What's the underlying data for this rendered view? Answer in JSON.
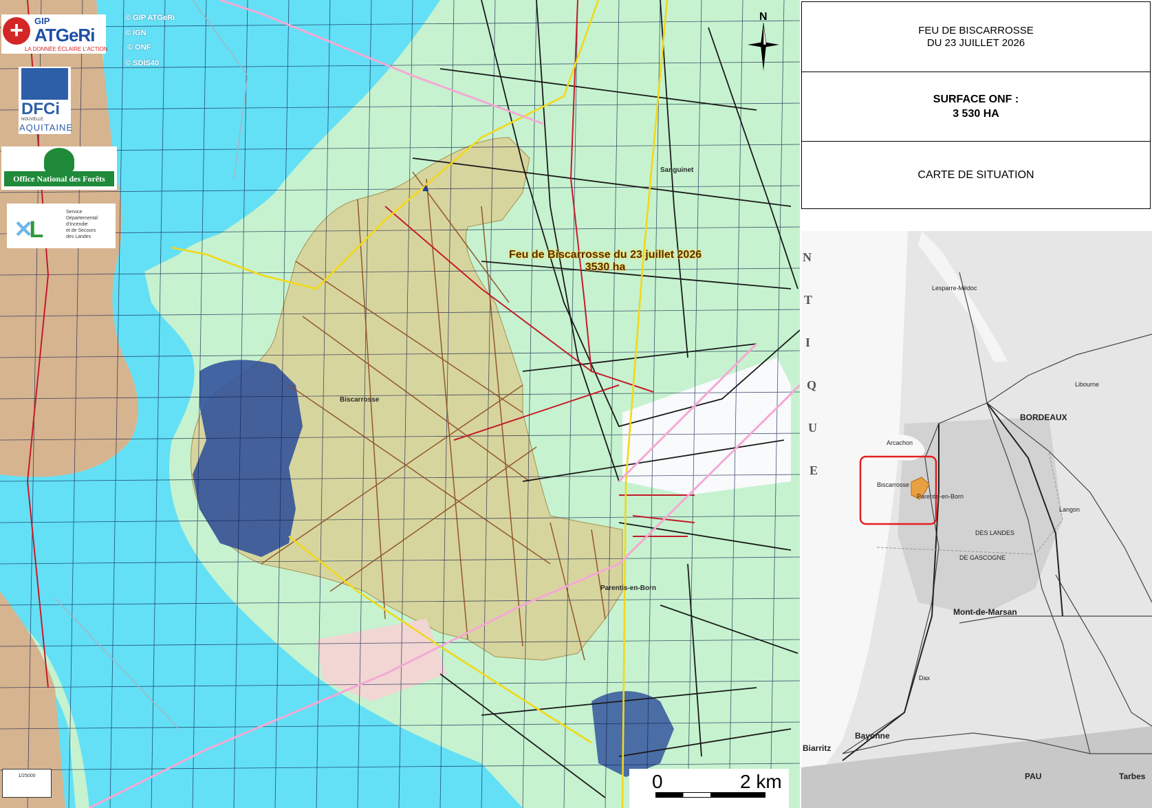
{
  "map": {
    "copyright": [
      "© GIP ATGeRi",
      "© IGN",
      "© ONF",
      "© SDIS40"
    ],
    "fire_title_line1": "Feu de Biscarrosse du 23 juillet 2026",
    "fire_title_line2": "3530 ha",
    "places": {
      "biscarrosse": "Biscarrosse",
      "sanguinet": "Sanguinet",
      "parentis": "Parentis-en-Born"
    },
    "scale": {
      "start": "0",
      "end": "2 km"
    },
    "corner_scale_text": "1/25000",
    "compass_icon": "north-arrow-icon"
  },
  "logos": {
    "atgeri_top": "GIP",
    "atgeri_name": "ATGeRi",
    "atgeri_tagline": "LA DONNÉE ÉCLAIRE L'ACTION",
    "dfci_name": "DFCi",
    "dfci_sub1": "NOUVELLE",
    "dfci_sub2": "AQUITAINE",
    "onf_name": "Office National des Forêts",
    "sdis_lines": [
      "Service",
      "Départemental",
      "d'Incendie",
      "et de Secours",
      "des Landes"
    ]
  },
  "panel": {
    "title_line1": "FEU DE BISCARROSSE",
    "title_line2": "DU 23 JUILLET 2026",
    "surface_line1": "SURFACE ONF :",
    "surface_line2": "3 530 HA",
    "situation": "CARTE DE SITUATION"
  },
  "inset": {
    "bordeaux": "BORDEAUX",
    "arcachon": "Arcachon",
    "biscarrosse": "Biscarrosse",
    "parentis": "Parentis-en-Born",
    "mont_de_marsan": "Mont-de-Marsan",
    "bayonne": "Bayonne",
    "biarritz": "Biarritz",
    "pau": "PAU",
    "tarbes": "Tarbes",
    "dax": "Dax",
    "lesparre": "Lesparre-Médoc",
    "langon": "Langon",
    "libourne": "Libourne",
    "landes": "DES LANDES",
    "gascogne": "DE GASCOGNE",
    "ocean_letters": [
      "N",
      "T",
      "I",
      "Q",
      "U",
      "E"
    ],
    "colors": {
      "highlight": "#e41f1f",
      "fire": "#e8a040"
    }
  },
  "colors": {
    "water": "#63e0f5",
    "land": "#c6f2cf",
    "burned": "#d8d49c",
    "urban": "#1e3f9a",
    "roads": "#1a1a1a"
  }
}
